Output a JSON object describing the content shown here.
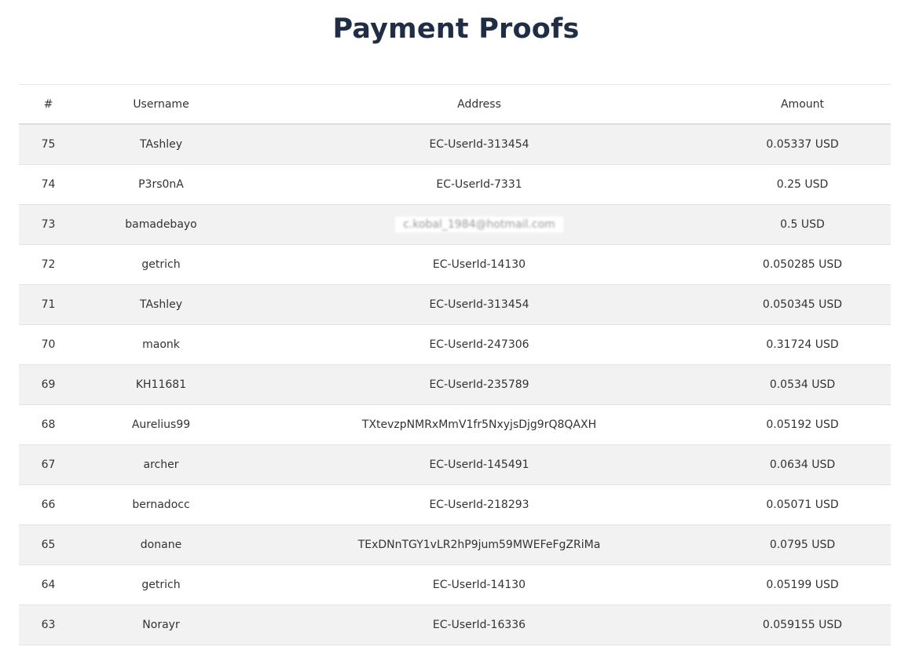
{
  "page": {
    "title": "Payment Proofs"
  },
  "table": {
    "headers": {
      "number": "#",
      "username": "Username",
      "address": "Address",
      "amount": "Amount"
    },
    "rows": [
      {
        "number": "75",
        "username": "TAshley",
        "address": "EC-UserId-313454",
        "amount": "0.05337 USD"
      },
      {
        "number": "74",
        "username": "P3rs0nA",
        "address": "EC-UserId-7331",
        "amount": "0.25 USD"
      },
      {
        "number": "73",
        "username": "bamadebayo",
        "address": "c.kobal_1984@hotmail.com",
        "amount": "0.5 USD",
        "address_obscured": true
      },
      {
        "number": "72",
        "username": "getrich",
        "address": "EC-UserId-14130",
        "amount": "0.050285 USD"
      },
      {
        "number": "71",
        "username": "TAshley",
        "address": "EC-UserId-313454",
        "amount": "0.050345 USD"
      },
      {
        "number": "70",
        "username": "maonk",
        "address": "EC-UserId-247306",
        "amount": "0.31724 USD"
      },
      {
        "number": "69",
        "username": "KH11681",
        "address": "EC-UserId-235789",
        "amount": "0.0534 USD"
      },
      {
        "number": "68",
        "username": "Aurelius99",
        "address": "TXtevzpNMRxMmV1fr5NxyjsDjg9rQ8QAXH",
        "amount": "0.05192 USD"
      },
      {
        "number": "67",
        "username": "archer",
        "address": "EC-UserId-145491",
        "amount": "0.0634 USD"
      },
      {
        "number": "66",
        "username": "bernadocc",
        "address": "EC-UserId-218293",
        "amount": "0.05071 USD"
      },
      {
        "number": "65",
        "username": "donane",
        "address": "TExDNnTGY1vLR2hP9jum59MWEFeFgZRiMa",
        "amount": "0.0795 USD"
      },
      {
        "number": "64",
        "username": "getrich",
        "address": "EC-UserId-14130",
        "amount": "0.05199 USD"
      },
      {
        "number": "63",
        "username": "Norayr",
        "address": "EC-UserId-16336",
        "amount": "0.059155 USD"
      }
    ]
  },
  "colors": {
    "title": "#1f2d45",
    "text": "#333333",
    "row_stripe": "#f2f2f2",
    "row_plain": "#ffffff",
    "border": "#e2e2e2"
  }
}
